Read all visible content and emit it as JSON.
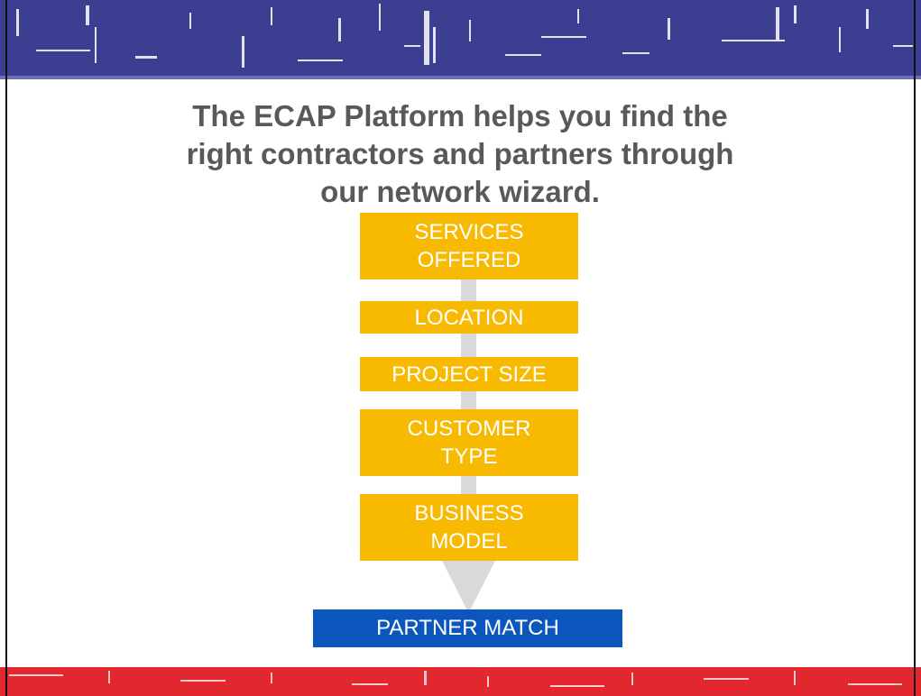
{
  "slide": {
    "title_lines": [
      "The ECAP Platform helps you find the",
      "right contractors and partners through",
      "our network wizard."
    ],
    "steps": [
      {
        "lines": [
          "SERVICES",
          "OFFERED"
        ]
      },
      {
        "lines": [
          "LOCATION"
        ]
      },
      {
        "lines": [
          "PROJECT SIZE"
        ]
      },
      {
        "lines": [
          "CUSTOMER",
          "TYPE"
        ]
      },
      {
        "lines": [
          "BUSINESS",
          "MODEL"
        ]
      }
    ],
    "result": {
      "label": "PARTNER MATCH"
    }
  },
  "colors": {
    "top_band": "#3B3E91",
    "bottom_band": "#E2282E",
    "step_fill": "#F8BA00",
    "result_fill": "#0B57BE",
    "arrow": "#D9D9D9",
    "title_text": "#595959"
  }
}
